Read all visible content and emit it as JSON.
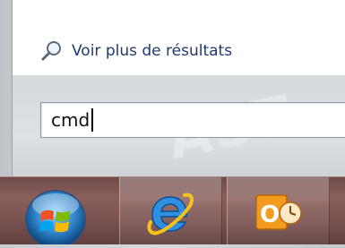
{
  "start_menu": {
    "see_more_results_label": "Voir plus de résultats",
    "search_value": "cmd",
    "watermark_text": "Astuce"
  },
  "taskbar": {
    "start_button": "start-orb",
    "pinned_apps": [
      {
        "name": "Internet Explorer",
        "icon": "internet-explorer-icon"
      },
      {
        "name": "Outlook",
        "icon": "outlook-icon"
      }
    ]
  },
  "colors": {
    "link_text": "#1e3a6e",
    "taskbar": "#7a5250"
  }
}
